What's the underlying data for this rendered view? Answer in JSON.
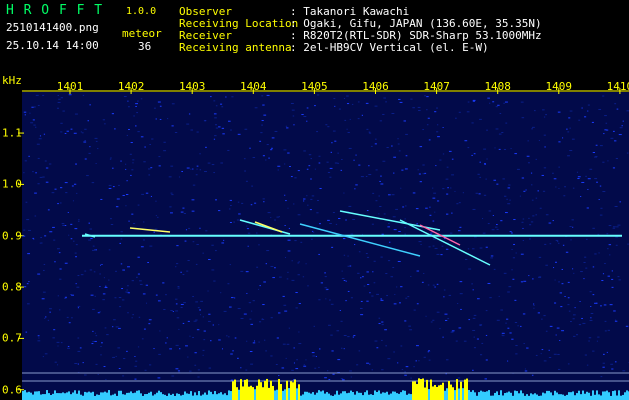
{
  "app": {
    "title": "H R O F F T",
    "version": "1.0.0",
    "filename": "2510141400.png",
    "datetime": "25.10.14 14:00",
    "event_label": "meteor",
    "event_count": "36"
  },
  "info": {
    "rows": [
      {
        "key": "Observer",
        "value": ": Takanori Kawachi"
      },
      {
        "key": "Receiving Location",
        "value": ": Ogaki, Gifu, JAPAN (136.60E, 35.35N)"
      },
      {
        "key": "Receiver",
        "value": ": R820T2(RTL-SDR) SDR-Sharp 53.1000MHz"
      },
      {
        "key": "Receiving antenna",
        "value": ": 2el-HB9CV Vertical (el. E-W)"
      }
    ]
  },
  "chart_data": {
    "type": "heatmap",
    "ylabel": "kHz",
    "x_ticks": [
      "1401",
      "1402",
      "1403",
      "1404",
      "1405",
      "1406",
      "1407",
      "1408",
      "1409",
      "1410"
    ],
    "y_ticks": [
      "1.1",
      "1.0",
      "0.9",
      "0.8",
      "0.7",
      "0.6"
    ],
    "ylim": [
      0.58,
      1.18
    ],
    "carrier_khz": 0.9,
    "colors": {
      "background": "#020a4a",
      "carrier": "#66ffff",
      "text": "#ffff00"
    }
  }
}
